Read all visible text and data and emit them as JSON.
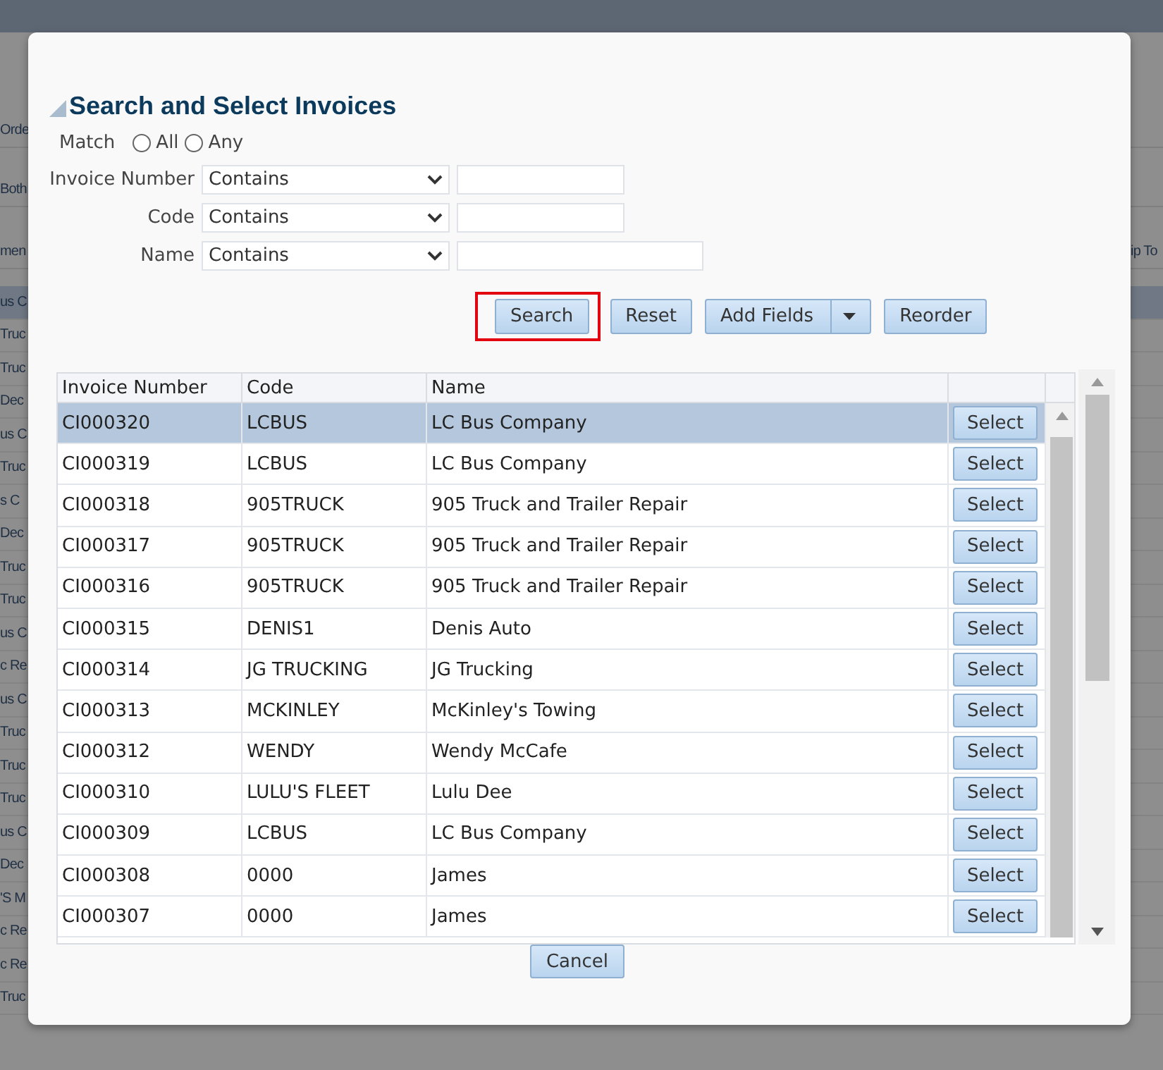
{
  "background": {
    "top_labels": [
      {
        "left": "Orde"
      },
      {
        "left": "Both"
      },
      {
        "left": "men",
        "right": "ip To"
      }
    ],
    "rows": [
      "us C",
      "Truc",
      "Truc",
      "Dec",
      "us C",
      "Truc",
      "s C",
      "Dec",
      "Truc",
      "Truc",
      "us C",
      "c Re",
      "us C",
      "Truc",
      "Truc",
      "Truc",
      "us C",
      "Dec",
      "'S M",
      "c Re",
      "c Re",
      "Truc"
    ]
  },
  "dialog": {
    "title": "Search and Select Invoices",
    "match": {
      "label": "Match",
      "options": [
        {
          "label": "All",
          "selected": false
        },
        {
          "label": "Any",
          "selected": false
        }
      ]
    },
    "criteria": [
      {
        "label": "Invoice Number",
        "operator": "Contains"
      },
      {
        "label": "Code",
        "operator": "Contains"
      },
      {
        "label": "Name",
        "operator": "Contains"
      }
    ],
    "buttons": [
      {
        "label": "Search",
        "kind": "plain",
        "highlighted": true
      },
      {
        "label": "Reset",
        "kind": "plain",
        "highlighted": false
      },
      {
        "label": "Add Fields",
        "kind": "menu",
        "highlighted": false
      },
      {
        "label": "Reorder",
        "kind": "plain",
        "highlighted": false
      }
    ],
    "table": {
      "columns": [
        "Invoice Number",
        "Code",
        "Name"
      ],
      "rows": [
        {
          "invoice_number": "CI000320",
          "code": "LCBUS",
          "name": "LC Bus Company",
          "action": "Select",
          "selected": true
        },
        {
          "invoice_number": "CI000319",
          "code": "LCBUS",
          "name": "LC Bus Company",
          "action": "Select",
          "selected": false
        },
        {
          "invoice_number": "CI000318",
          "code": "905TRUCK",
          "name": "905 Truck and Trailer Repair",
          "action": "Select",
          "selected": false
        },
        {
          "invoice_number": "CI000317",
          "code": "905TRUCK",
          "name": "905 Truck and Trailer Repair",
          "action": "Select",
          "selected": false
        },
        {
          "invoice_number": "CI000316",
          "code": "905TRUCK",
          "name": "905 Truck and Trailer Repair",
          "action": "Select",
          "selected": false
        },
        {
          "invoice_number": "CI000315",
          "code": "DENIS1",
          "name": "Denis Auto",
          "action": "Select",
          "selected": false
        },
        {
          "invoice_number": "CI000314",
          "code": "JG TRUCKING",
          "name": "JG Trucking",
          "action": "Select",
          "selected": false
        },
        {
          "invoice_number": "CI000313",
          "code": "MCKINLEY",
          "name": "McKinley's Towing",
          "action": "Select",
          "selected": false
        },
        {
          "invoice_number": "CI000312",
          "code": "WENDY",
          "name": "Wendy McCafe",
          "action": "Select",
          "selected": false
        },
        {
          "invoice_number": "CI000310",
          "code": "LULU'S FLEET",
          "name": "Lulu Dee",
          "action": "Select",
          "selected": false
        },
        {
          "invoice_number": "CI000309",
          "code": "LCBUS",
          "name": "LC Bus Company",
          "action": "Select",
          "selected": false
        },
        {
          "invoice_number": "CI000308",
          "code": "0000",
          "name": "James",
          "action": "Select",
          "selected": false
        },
        {
          "invoice_number": "CI000307",
          "code": "0000",
          "name": "James",
          "action": "Select",
          "selected": false
        }
      ]
    },
    "cancel": "Cancel"
  }
}
